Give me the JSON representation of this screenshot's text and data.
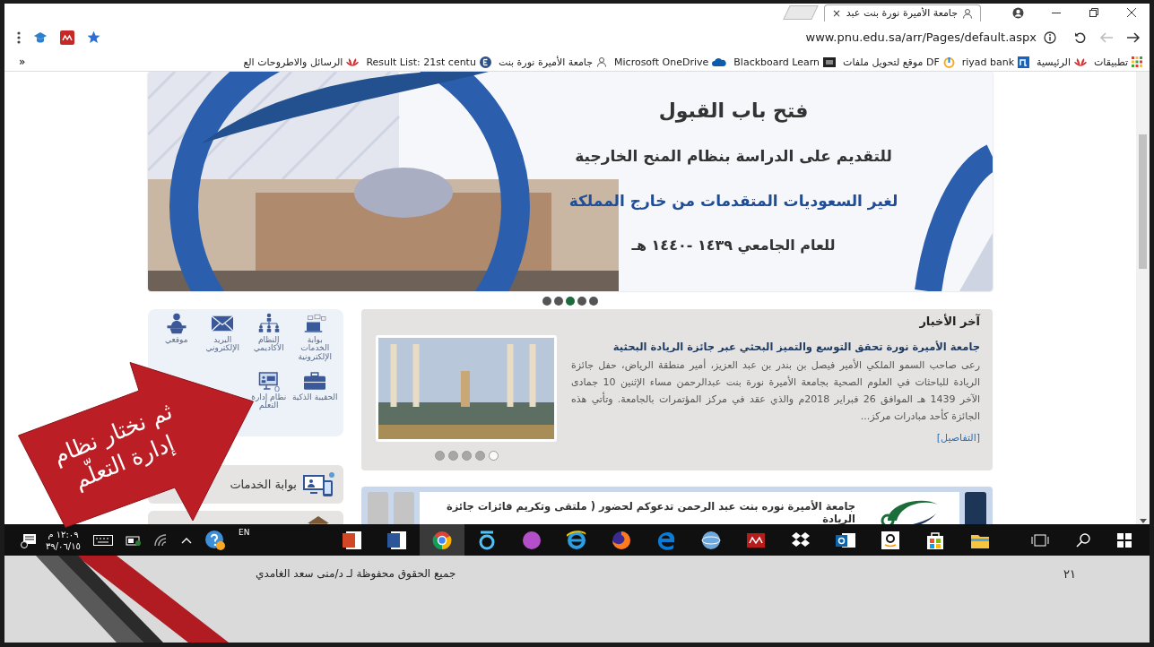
{
  "browser": {
    "tab": {
      "title": "جامعة الأميرة نورة بنت عبد",
      "close": "×"
    },
    "address": {
      "url": "www.pnu.edu.sa/arr/Pages/default.aspx"
    },
    "bookmarks": [
      {
        "label": "تطبيقات"
      },
      {
        "label": "الرئيسية"
      },
      {
        "label": "riyad bank"
      },
      {
        "label": "موقع لتحويل ملفات DF"
      },
      {
        "label": "Blackboard Learn"
      },
      {
        "label": "Microsoft OneDrive"
      },
      {
        "label": "جامعة الأميرة نورة بنت"
      },
      {
        "label": "Result List: 21st centu"
      },
      {
        "label": "الرسائل والاطروحات الع"
      }
    ],
    "bookmarks_overflow": "»"
  },
  "banner": {
    "lines": [
      "فتح باب القبول",
      "للتقديم على الدراسة بنظام المنح الخارجية",
      "لغير السعوديات المتقدمات من خارج المملكة",
      "للعام الجامعي ١٤٣٩ -١٤٤٠ هـ"
    ],
    "dots": [
      {
        "selected": false
      },
      {
        "selected": false
      },
      {
        "selected": true
      },
      {
        "selected": false
      },
      {
        "selected": false
      }
    ]
  },
  "quick_links": [
    {
      "kind": "laptop",
      "label": "بوابة الخدمات الإلكترونية"
    },
    {
      "kind": "hierarchy",
      "label": "النظام الأكاديمي"
    },
    {
      "kind": "envelope",
      "label": "البريد الإلكتروني"
    },
    {
      "kind": "speaker",
      "label": "موقعي"
    },
    {
      "kind": "briefcase",
      "label": "الحقيبة الذكية"
    },
    {
      "kind": "monitor",
      "label": "نظام إدارة التعلم"
    }
  ],
  "side_links": [
    {
      "label": "بوابة الخدمات"
    }
  ],
  "news": {
    "title": "آخر الأخبار",
    "headline": "جامعة الأميرة نورة تحقق التوسع والتميز البحثي عبر جائزة الريادة البحثية",
    "body": "رعى صاحب السمو الملكي الأمير فيصل بن بندر بن عبد العزيز، أمير منطقة الرياض، حفل جائزة الريادة للباحثات في العلوم الصحية بجامعة الأميرة نورة بنت عبدالرحمن مساء الإثنين 10 جمادى الآخر 1439 هـ الموافق 26 فبراير 2018م والذي عقد في مركز المؤتمرات بالجامعة. وتأتي هذه الجائزة كأحد مبادرات مركز...",
    "more": "[التفاصيل]",
    "dots": [
      {
        "selected": false
      },
      {
        "selected": false
      },
      {
        "selected": false
      },
      {
        "selected": false
      },
      {
        "selected": true
      }
    ]
  },
  "announcement": {
    "text": "جامعة الأميرة نوره بنت عبد الرحمن تدعوكم لحضور ( ملتقى وتكريم فائزات جائزة الريادة"
  },
  "taskbar": {
    "time": "١٢:٠٩ م",
    "date": "٣٩/٠٦/١٥",
    "language": "EN"
  },
  "callout": {
    "text": "ثم نختار نظام\nإدارة التعلّم"
  },
  "footer": {
    "credit": "جميع الحقوق محفوظة لـ د/منى سعد الغامدي",
    "slide_number": "٢١"
  }
}
